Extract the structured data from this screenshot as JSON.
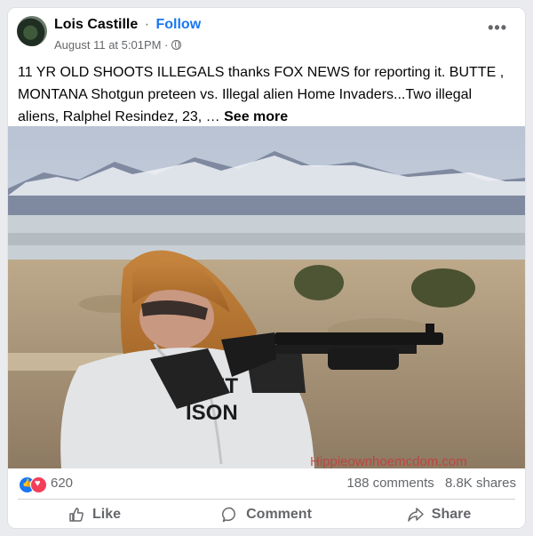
{
  "post": {
    "author": "Lois Castille",
    "separator": "·",
    "follow": "Follow",
    "timestamp": "August 11 at 5:01PM ·",
    "privacy_icon": "globe-icon",
    "more_icon": "•••",
    "text": "11 YR OLD SHOOTS ILLEGALS thanks FOX NEWS for reporting it. BUTTE , MONTANA Shotgun preteen vs. Illegal alien Home Invaders...Two illegal aliens, Ralphel Resindez, 23, … ",
    "see_more": "See more"
  },
  "image": {
    "shirt_text": "2ET\nISON",
    "watermark": "Hippieownhoemcdom.com"
  },
  "stats": {
    "reaction_count": "620",
    "comments": "188 comments",
    "shares": "8.8K shares"
  },
  "actions": {
    "like": "Like",
    "comment": "Comment",
    "share": "Share"
  },
  "colors": {
    "accent": "#1877f2",
    "love": "#f33e58",
    "secondary_text": "#65676b"
  }
}
